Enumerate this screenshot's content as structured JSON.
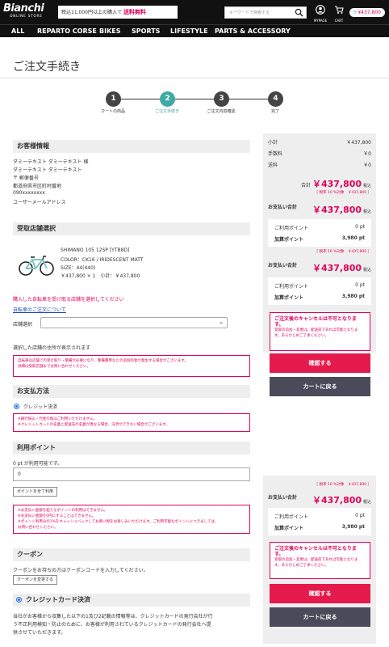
{
  "header": {
    "logo": "Bianchi",
    "logo_sub": "ONLINE STORE",
    "promo_text": "税込11,000円以上の購入で",
    "promo_highlight": "送料無料",
    "search_placeholder": "キーワードで検索する",
    "mypage_label": "MYPAGE",
    "cart_label": "CART",
    "cart_total": "¥437,800"
  },
  "nav": {
    "items": [
      "ALL",
      "REPARTO CORSE",
      "BIKES",
      "SPORTS",
      "LIFESTYLE",
      "PARTS & ACCESSORY"
    ]
  },
  "page_title": "ご注文手続き",
  "steps": [
    {
      "num": "1",
      "label": "カートの商品"
    },
    {
      "num": "2",
      "label": "ご注文手続き"
    },
    {
      "num": "3",
      "label": "ご注文内容確認"
    },
    {
      "num": "4",
      "label": "完了"
    }
  ],
  "customer": {
    "heading": "お客様情報",
    "name_kanji": "ダミーテキスト ダミーテキスト 様",
    "name_kana": "ダミーテキスト ダミーテキスト",
    "postal": "〒 郵便番号",
    "address": "都道府県市区町村番地",
    "phone": "090xxxxxxxx",
    "email": "ユーザーメールアドレス"
  },
  "store": {
    "heading": "受取店舗選択",
    "product_name": "SHIMANO 105 12SP [YTB8D]",
    "color": "COLOR：CK16 / IRIDESCENT MATT",
    "size": "SIZE：44(440)",
    "price_line": "￥437,800 × 1　小計：￥437,800",
    "notice": "購入した自転車を受け取る店舗を選択してください",
    "link": "自転車のご注文について",
    "select_label": "店舗選択",
    "address_placeholder": "選択した店舗の住所が表示されます",
    "warning_1": "自転車は店舗での受け取り・整備が必要になり、整備費用などの追加料金が発生する場合がございます。",
    "warning_2": "詳細は受取店舗までお問い合わせください。"
  },
  "payment": {
    "heading": "お支払方法",
    "option": "クレジット決済",
    "warning_1": "※銀行振込・代金引換はご利用いただけません。",
    "warning_2": "※クレジットカードの名義と配送先の名義が異なる場合、決済ができない場合がございます。"
  },
  "points": {
    "heading": "利用ポイント",
    "available": "0 pt が利用可能です。",
    "input_value": "0",
    "use_all_button": "ポイントを全て利用",
    "warning_1": "※お支払い金額を超えるポイントの利用はできません。",
    "warning_2": "※お支払い金額を0円にすることはできません。",
    "warning_3": "※ポイント利用分の1%をキャッシュバックしてお買い物をお楽しみいただけます。ご利用可能なポイントにつきましては、",
    "warning_4": "お問い合わせください。"
  },
  "coupon": {
    "heading": "クーポン",
    "text": "クーポンをお持ちの方はクーポンコードを入力してください。",
    "button": "クーポンを変更する"
  },
  "credit": {
    "heading": "クレジットカード決済",
    "text_1": "当社がお客様から収集した以下の1及び2記載の情報等は、クレジットカードの発行会社が行",
    "text_2": "う不正利用検知・防止のために、お客様が利用されているクレジットカードの発行会社へ提",
    "text_3": "供させていただきます。"
  },
  "summary": {
    "subtotal_label": "小計",
    "subtotal": "￥437,800",
    "fee_label": "手数料",
    "fee": "￥0",
    "shipping_label": "送料",
    "shipping": "￥0",
    "total_label": "合計",
    "total": "￥437,800",
    "tax_suffix": "税込",
    "tax_note": "［ 税率 10 %対象　￥437,800 ］",
    "pay_label": "お支払い合計",
    "pay_total": "￥437,800",
    "use_points_label": "ご利用ポイント",
    "use_points": "0 pt",
    "earn_points_label": "加算ポイント",
    "earn_points": "3,980 pt",
    "cancel_title": "ご注文後のキャンセルは不可となります。",
    "cancel_text_1": "受取の追加・変更は、配送前であれば可能となりま",
    "cancel_text_2": "す。あらかじめご了承ください。",
    "confirm_button": "確認する",
    "back_button": "カートに戻る"
  },
  "colors": {
    "accent": "#e0005a",
    "step_active": "#3fa9a4",
    "header_bg": "#111111"
  }
}
